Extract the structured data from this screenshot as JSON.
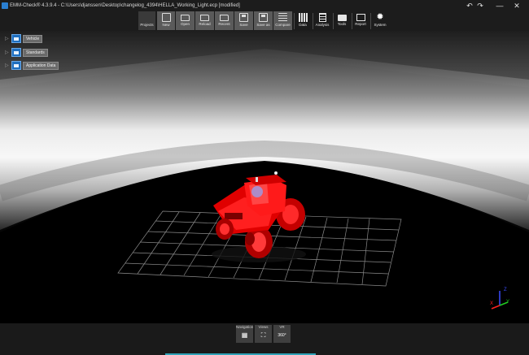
{
  "window": {
    "title": "EMM-Check® 4.3.9.4  - C:\\Users\\djanssen\\Desktop\\changelog_4394\\HELLA_Working_Light.ecp [modified]",
    "controls": {
      "undo": "↶",
      "redo": "↷",
      "minimize": "—",
      "close": "✕"
    }
  },
  "toolbar": {
    "items": [
      {
        "label": "Projects",
        "icon": "projects-icon"
      },
      {
        "label": "New",
        "icon": "new-file-icon"
      },
      {
        "label": "Open",
        "icon": "open-folder-icon"
      },
      {
        "label": "Reload",
        "icon": "reload-folder-icon"
      },
      {
        "label": "Recent",
        "icon": "recent-folder-icon"
      },
      {
        "label": "Save",
        "icon": "save-icon"
      },
      {
        "label": "Save as",
        "icon": "save-as-icon"
      },
      {
        "label": "Compare",
        "icon": "compare-icon"
      },
      {
        "label": "Data",
        "icon": "data-icon"
      },
      {
        "label": "Analysis",
        "icon": "analysis-icon"
      },
      {
        "label": "Tools",
        "icon": "tools-icon"
      },
      {
        "label": "Report",
        "icon": "report-icon"
      },
      {
        "label": "System",
        "icon": "system-gear-icon"
      }
    ]
  },
  "tree": {
    "items": [
      {
        "label": "Vehicle",
        "icon": "vehicle-icon"
      },
      {
        "label": "Standards",
        "icon": "standards-icon"
      },
      {
        "label": "Application Data",
        "icon": "application-data-icon"
      }
    ]
  },
  "axes": {
    "x": "X",
    "y": "Y",
    "z": "Z"
  },
  "colors": {
    "vehicle": "#e00000",
    "axis_x": "#ff2020",
    "axis_y": "#22cc22",
    "axis_z": "#3a4cff"
  },
  "bottom": {
    "navigation": {
      "label": "Navigation",
      "icon": "navigation-grid-icon"
    },
    "views": {
      "label": "Views",
      "icon": "fullscreen-icon"
    },
    "vr": {
      "label": "VR",
      "icon": "vr-360-icon",
      "text": "360°"
    }
  }
}
